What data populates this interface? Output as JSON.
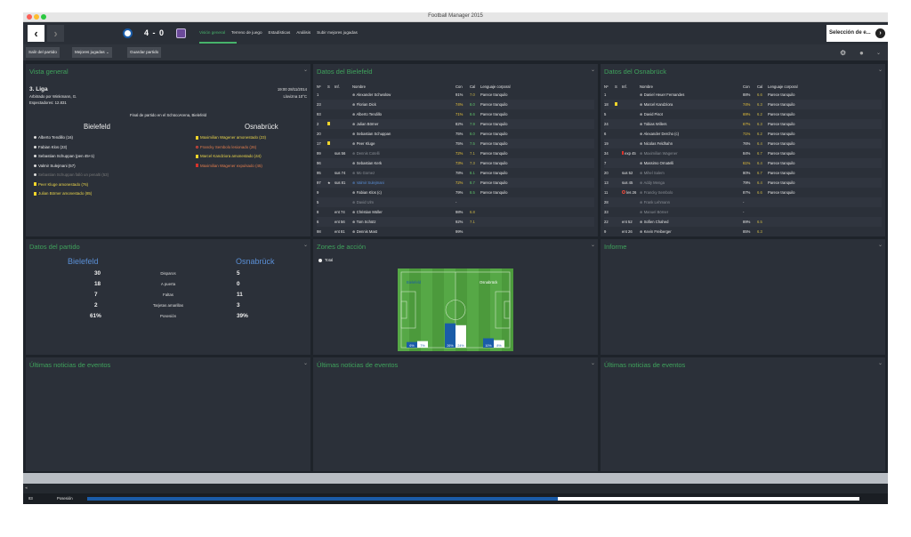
{
  "window": {
    "title": "Football Manager 2015"
  },
  "colors": {
    "accent_green": "#47b36b",
    "bielefeld_blue": "#1a5ca8",
    "osnabruck_purple": "#6b4a9a"
  },
  "header": {
    "score": "4 - 0",
    "nav": [
      "Visión general",
      "Terreno de juego",
      "Estadísticas",
      "Análisis",
      "Subir mejores jugadas"
    ],
    "select_button": "Selección de e..."
  },
  "toolbar": {
    "leave": "Salir del partido",
    "highlights": "Mejores jugadas",
    "save": "Guardar partido"
  },
  "overview": {
    "title": "Vista general",
    "competition": "3. Liga",
    "datetime": "19:00 28/11/2014",
    "referee": "Arbitrado por Winkmann, G.",
    "weather": "Llovizna 10°C",
    "attendance": "Espectadores: 12.831",
    "final": "Final de partido en el SchücoArena, Bielefeld",
    "home": "Bielefeld",
    "away": "Osnabrück",
    "home_events": [
      {
        "text": "Alberto Tendillo (16)",
        "type": "goal"
      },
      {
        "text": "Fabian Klos (23)",
        "type": "goal"
      },
      {
        "text": "Sebastian Schuppan (pen 45+1)",
        "type": "goal"
      },
      {
        "text": "Valmir Sulejmani (57)",
        "type": "goal"
      },
      {
        "text": "Sebastian Schuppan falló un penalti (53)",
        "type": "miss"
      },
      {
        "text": "Peer Kluge amonestado (76)",
        "type": "yellow"
      },
      {
        "text": "Julian Börner amonestado (85)",
        "type": "yellow"
      }
    ],
    "away_events": [
      {
        "text": "Maximilian Wagener amonestado (23)",
        "type": "yellow"
      },
      {
        "text": "Francky Sembolo lesionado (26)",
        "type": "injury"
      },
      {
        "text": "Marcel Kandziora amonestado (44)",
        "type": "yellow"
      },
      {
        "text": "Maximilian Wagener expulsado (45)",
        "type": "red"
      }
    ]
  },
  "bielefeld": {
    "title": "Datos del Bielefeld",
    "headers": [
      "Nº",
      "S",
      "Inf.",
      "Nombre",
      "Con",
      "Cal",
      "Lenguaje corporal"
    ],
    "rows": [
      {
        "num": "1",
        "s": "",
        "inf": "",
        "name": "Alexander Schwolow",
        "con": "91%",
        "cal": "7.0",
        "bl": "Parece tranquilo"
      },
      {
        "num": "23",
        "s": "",
        "inf": "",
        "name": "Florian Dick",
        "con": "74%",
        "cal": "8.0",
        "bl": "Parece tranquilo"
      },
      {
        "num": "93",
        "s": "",
        "inf": "",
        "name": "Alberto Tendillo",
        "con": "71%",
        "cal": "8.6",
        "bl": "Parece tranquilo"
      },
      {
        "num": "2",
        "s": "y",
        "inf": "",
        "name": "Julian Börner",
        "con": "82%",
        "cal": "7.9",
        "bl": "Parece tranquilo"
      },
      {
        "num": "20",
        "s": "",
        "inf": "",
        "name": "Sebastian Schuppan",
        "con": "75%",
        "cal": "8.0",
        "bl": "Parece tranquilo"
      },
      {
        "num": "17",
        "s": "y",
        "inf": "",
        "name": "Peer Kluge",
        "con": "75%",
        "cal": "7.5",
        "bl": "Parece tranquilo"
      },
      {
        "num": "99",
        "s": "",
        "inf": "sus 56",
        "name": "Dennis Cotelli",
        "con": "72%",
        "cal": "7.1",
        "bl": "Parece tranquilo"
      },
      {
        "num": "96",
        "s": "",
        "inf": "",
        "name": "Sebastian Kerk",
        "con": "73%",
        "cal": "7.3",
        "bl": "Parece tranquilo"
      },
      {
        "num": "95",
        "s": "",
        "inf": "sus 74",
        "name": "Mo Gomez",
        "con": "78%",
        "cal": "8.1",
        "bl": "Parece tranquilo"
      },
      {
        "num": "97",
        "s": "★",
        "inf": "sus 81",
        "name": "Valmir Sulejmani",
        "con": "72%",
        "cal": "8.7",
        "bl": "Parece tranquilo"
      },
      {
        "num": "9",
        "s": "",
        "inf": "",
        "name": "Fabian Klos (c)",
        "con": "79%",
        "cal": "8.5",
        "bl": "Parece tranquilo"
      },
      {
        "num": "5",
        "s": "",
        "inf": "",
        "name": "David Ulm",
        "con": "-",
        "cal": "",
        "bl": ""
      },
      {
        "num": "8",
        "s": "",
        "inf": "ent 74",
        "name": "Christian Müller",
        "con": "98%",
        "cal": "6.8",
        "bl": ""
      },
      {
        "num": "6",
        "s": "",
        "inf": "ent 56",
        "name": "Tom Schütz",
        "con": "92%",
        "cal": "7.1",
        "bl": ""
      },
      {
        "num": "98",
        "s": "",
        "inf": "ent 81",
        "name": "Dennis Mast",
        "con": "99%",
        "cal": "",
        "bl": ""
      }
    ]
  },
  "osnabruck": {
    "title": "Datos del Osnabrück",
    "headers": [
      "Nº",
      "S",
      "Inf.",
      "Nombre",
      "Con",
      "Cal",
      "Lenguaje corporal"
    ],
    "rows": [
      {
        "num": "1",
        "s": "",
        "inf": "",
        "name": "Daniel Heuer Fernandes",
        "con": "88%",
        "cal": "6.6",
        "bl": "Parece tranquilo"
      },
      {
        "num": "18",
        "s": "y",
        "inf": "",
        "name": "Marcel Kandziora",
        "con": "74%",
        "cal": "6.3",
        "bl": "Parece tranquilo"
      },
      {
        "num": "5",
        "s": "",
        "inf": "",
        "name": "David Pisot",
        "con": "69%",
        "cal": "6.2",
        "bl": "Parece tranquilo"
      },
      {
        "num": "24",
        "s": "",
        "inf": "",
        "name": "Tobias Willers",
        "con": "67%",
        "cal": "6.3",
        "bl": "Parece tranquilo"
      },
      {
        "num": "6",
        "s": "",
        "inf": "",
        "name": "Alexander Dercho (c)",
        "con": "71%",
        "cal": "6.2",
        "bl": "Parece tranquilo"
      },
      {
        "num": "19",
        "s": "",
        "inf": "",
        "name": "Nicolas Feldhahn",
        "con": "76%",
        "cal": "6.4",
        "bl": "Parece tranquilo"
      },
      {
        "num": "34",
        "s": "",
        "inf": "exp 45",
        "name": "Maximilian Wagener",
        "con": "84%",
        "cal": "6.7",
        "bl": "Parece tranquilo"
      },
      {
        "num": "7",
        "s": "",
        "inf": "",
        "name": "Massimo Ornatelli",
        "con": "61%",
        "cal": "6.4",
        "bl": "Parece tranquilo"
      },
      {
        "num": "20",
        "s": "",
        "inf": "sus 52",
        "name": "Mihel Salem",
        "con": "80%",
        "cal": "6.7",
        "bl": "Parece tranquilo"
      },
      {
        "num": "13",
        "s": "",
        "inf": "sus 45",
        "name": "Addy Menga",
        "con": "79%",
        "cal": "6.4",
        "bl": "Parece tranquilo"
      },
      {
        "num": "11",
        "s": "",
        "inf": "les 26",
        "name": "Francky Sembolo",
        "con": "87%",
        "cal": "6.6",
        "bl": "Parece tranquilo"
      },
      {
        "num": "28",
        "s": "",
        "inf": "",
        "name": "Frank Lehmann",
        "con": "-",
        "cal": "",
        "bl": ""
      },
      {
        "num": "33",
        "s": "",
        "inf": "",
        "name": "Manuel Börner",
        "con": "-",
        "cal": "",
        "bl": ""
      },
      {
        "num": "22",
        "s": "",
        "inf": "ent 52",
        "name": "Sofien Chahed",
        "con": "89%",
        "cal": "6.5",
        "bl": ""
      },
      {
        "num": "9",
        "s": "",
        "inf": "ent 26",
        "name": "Kevin Freiberger",
        "con": "85%",
        "cal": "6.3",
        "bl": ""
      }
    ]
  },
  "match_stats": {
    "title": "Datos del partido",
    "home": "Bielefeld",
    "away": "Osnabrück",
    "rows": [
      {
        "home": "30",
        "label": "Disparos",
        "away": "5"
      },
      {
        "home": "18",
        "label": "A puerta",
        "away": "0"
      },
      {
        "home": "7",
        "label": "Faltas",
        "away": "11"
      },
      {
        "home": "2",
        "label": "Tarjetas amarillas",
        "away": "3"
      },
      {
        "home": "61%",
        "label": "Posesión",
        "away": "39%"
      }
    ]
  },
  "zones": {
    "title": "Zones de acción",
    "filter": "Total",
    "home_label": "Bielefeld",
    "away_label": "Osnabrück",
    "bars": [
      {
        "home": 6,
        "away": 7,
        "home_label": "6%",
        "away_label": "7%"
      },
      {
        "home": 26,
        "away": 24,
        "home_label": "26%",
        "away_label": "24%"
      },
      {
        "home": 10,
        "away": 8,
        "home_label": "10%",
        "away_label": "8%"
      }
    ]
  },
  "report": {
    "title": "Informe"
  },
  "news": [
    {
      "title": "Últimas noticias de eventos"
    },
    {
      "title": "Últimas noticias de eventos"
    },
    {
      "title": "Últimas noticias de eventos"
    }
  ],
  "footer": {
    "minute": "83",
    "possession_label": "Posesión",
    "possession_home": 61
  }
}
